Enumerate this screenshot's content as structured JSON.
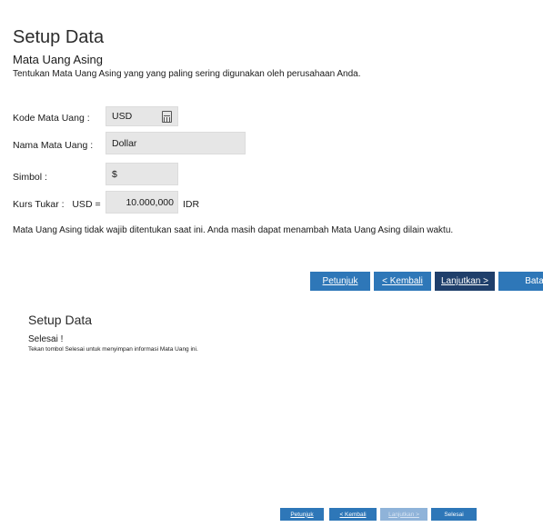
{
  "colors": {
    "button_primary": "#2e77b8",
    "button_active": "#1f3f6b",
    "button_disabled": "#8fb3d9",
    "field_bg": "#e6e6e6"
  },
  "step1": {
    "title": "Setup Data",
    "subtitle": "Mata Uang Asing",
    "description": "Tentukan Mata Uang Asing yang yang paling sering digunakan oleh perusahaan Anda.",
    "fields": {
      "kode_label": "Kode Mata Uang :",
      "kode_value": "USD",
      "nama_label": "Nama Mata Uang :",
      "nama_value": "Dollar",
      "simbol_label": "Simbol :",
      "simbol_value": "$",
      "kurs_label": "Kurs Tukar :   USD =",
      "kurs_value": "10.000,000",
      "kurs_unit": "IDR"
    },
    "note": "Mata Uang Asing tidak wajib ditentukan saat ini. Anda masih dapat menambah Mata Uang Asing dilain waktu.",
    "buttons": {
      "petunjuk": "Petunjuk",
      "kembali": "< Kembali",
      "lanjutkan": "Lanjutkan >",
      "batal": "Batal"
    }
  },
  "step2": {
    "title": "Setup Data",
    "subtitle": "Selesai !",
    "description": "Tekan tombol Selesai untuk menyimpan informasi Mata Uang ini.",
    "buttons": {
      "petunjuk": "Petunjuk",
      "kembali": "< Kembali",
      "lanjutkan": "Lanjutkan >",
      "selesai": "Selesai"
    }
  }
}
